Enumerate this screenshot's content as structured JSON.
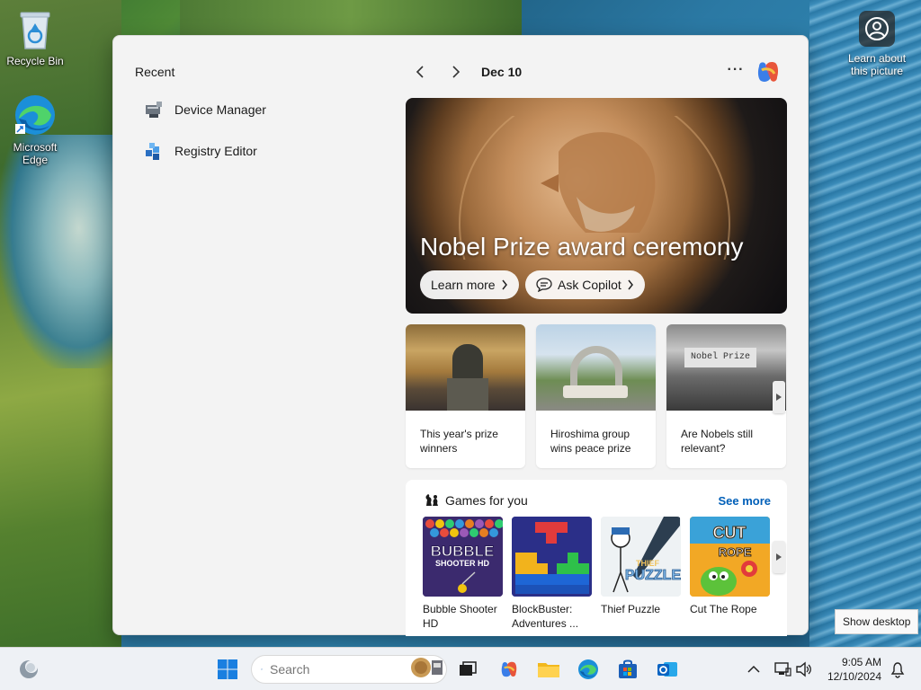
{
  "desktop": {
    "icons": [
      {
        "label": "Recycle Bin"
      },
      {
        "label": "Microsoft Edge"
      }
    ],
    "learn_label": "Learn about this picture"
  },
  "panel": {
    "recent_title": "Recent",
    "recent_items": [
      {
        "label": "Device Manager",
        "icon": "device-manager-icon"
      },
      {
        "label": "Registry Editor",
        "icon": "registry-editor-icon"
      }
    ],
    "date": "Dec 10",
    "more_label": "···",
    "hero": {
      "title": "Nobel Prize award ceremony",
      "learn_more": "Learn more",
      "ask_copilot": "Ask Copilot"
    },
    "cards": [
      {
        "caption": "This year's prize winners"
      },
      {
        "caption": "Hiroshima group wins peace prize"
      },
      {
        "caption": "Are Nobels still relevant?"
      }
    ],
    "card3_sign": "Nobel Prize",
    "games": {
      "title": "Games for you",
      "see_more": "See more",
      "items": [
        {
          "name": "Bubble Shooter HD",
          "logo": "BUBBLE SHOOTER HD"
        },
        {
          "name": "BlockBuster: Adventures ...",
          "logo": ""
        },
        {
          "name": "Thief Puzzle",
          "logo": "THIEF PUZZLE"
        },
        {
          "name": "Cut The Rope",
          "logo": "CUT ROPE"
        }
      ]
    }
  },
  "tooltip": "Show desktop",
  "taskbar": {
    "search_placeholder": "Search",
    "time": "9:05 AM",
    "date": "12/10/2024"
  },
  "colors": {
    "accent": "#005fb8",
    "panel_bg": "#f3f3f3",
    "taskbar_bg": "#eef1f5"
  }
}
